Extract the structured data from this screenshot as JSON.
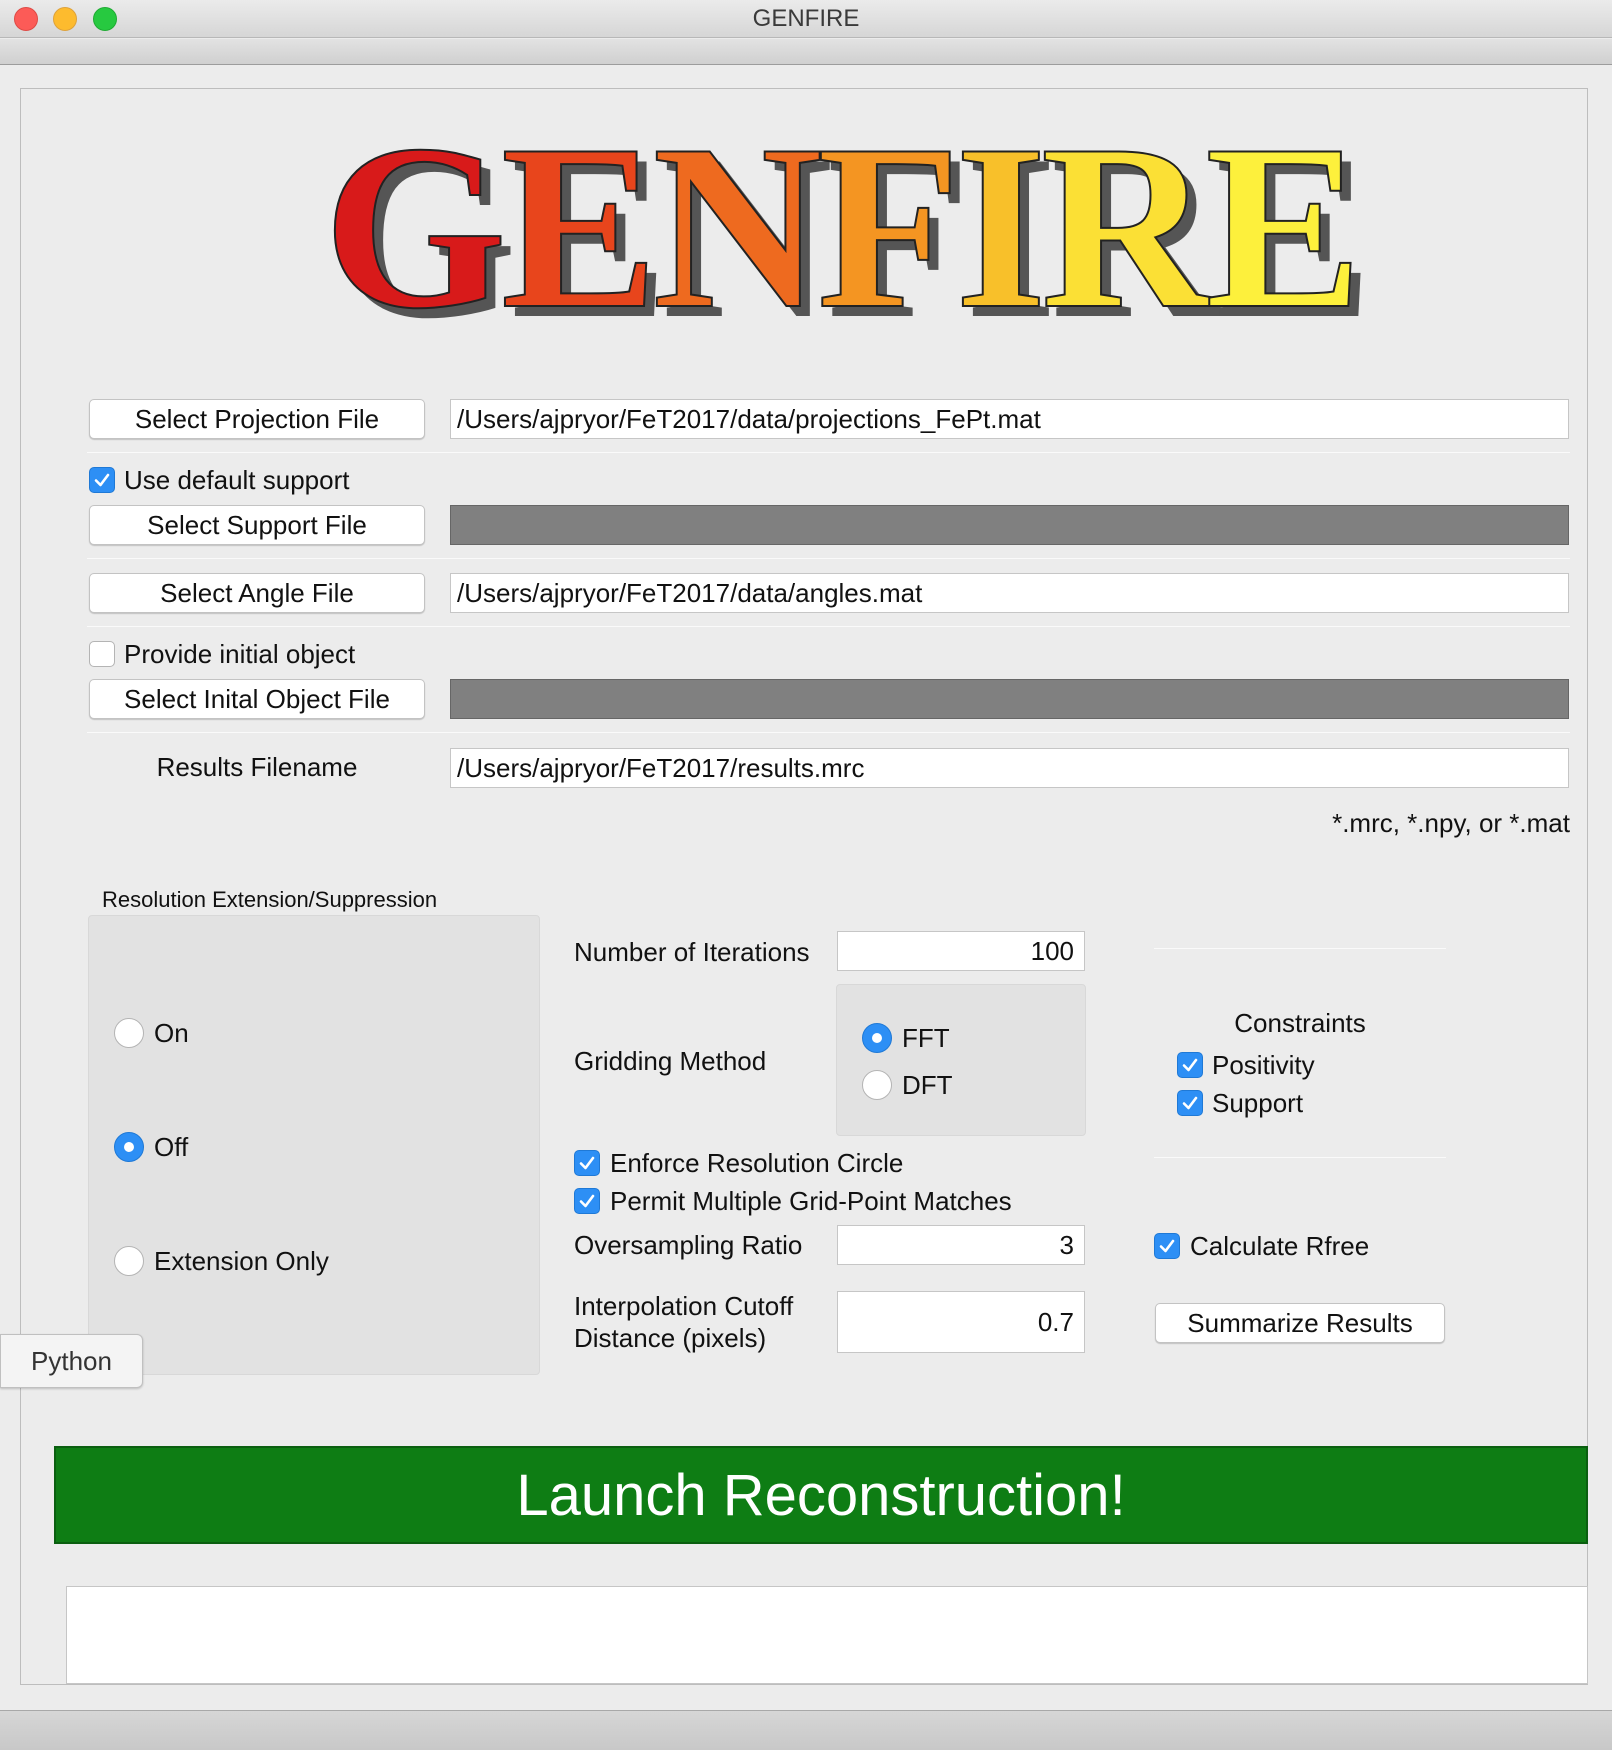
{
  "window": {
    "title": "GENFIRE"
  },
  "logo": {
    "letters": [
      {
        "ch": "G",
        "color": "#d81a1a"
      },
      {
        "ch": "E",
        "color": "#e8451c"
      },
      {
        "ch": "N",
        "color": "#ee6a1f"
      },
      {
        "ch": "F",
        "color": "#f49522"
      },
      {
        "ch": "I",
        "color": "#f8c02a"
      },
      {
        "ch": "R",
        "color": "#fbe035"
      },
      {
        "ch": "E",
        "color": "#fdf03c"
      }
    ]
  },
  "files": {
    "projection_button": "Select Projection File",
    "projection_path": "/Users/ajpryor/FeT2017/data/projections_FePt.mat",
    "use_default_support_label": "Use default support",
    "use_default_support_checked": true,
    "support_button": "Select Support File",
    "support_path": "",
    "angle_button": "Select Angle File",
    "angle_path": "/Users/ajpryor/FeT2017/data/angles.mat",
    "provide_initial_label": "Provide initial object",
    "provide_initial_checked": false,
    "initial_button": "Select Inital Object File",
    "initial_path": "",
    "results_label": "Results Filename",
    "results_path": "/Users/ajpryor/FeT2017/results.mrc",
    "results_hint": "*.mrc, *.npy, or *.mat"
  },
  "resolution": {
    "group_title": "Resolution Extension/Suppression",
    "options": [
      {
        "label": "On",
        "selected": false
      },
      {
        "label": "Off",
        "selected": true
      },
      {
        "label": "Extension Only",
        "selected": false
      }
    ]
  },
  "params": {
    "iterations_label": "Number of Iterations",
    "iterations_value": "100",
    "gridding_label": "Gridding Method",
    "gridding_options": [
      {
        "label": "FFT",
        "selected": true
      },
      {
        "label": "DFT",
        "selected": false
      }
    ],
    "enforce_resolution_label": "Enforce Resolution Circle",
    "enforce_resolution_checked": true,
    "permit_multiple_label": "Permit Multiple Grid-Point Matches",
    "permit_multiple_checked": true,
    "oversampling_label": "Oversampling Ratio",
    "oversampling_value": "3",
    "interp_label_line1": "Interpolation Cutoff",
    "interp_label_line2": "Distance (pixels)",
    "interp_value": "0.7"
  },
  "constraints": {
    "title": "Constraints",
    "positivity_label": "Positivity",
    "positivity_checked": true,
    "support_label": "Support",
    "support_checked": true,
    "rfree_label": "Calculate Rfree",
    "rfree_checked": true,
    "summarize_button": "Summarize Results"
  },
  "launch": {
    "label": "Launch Reconstruction!",
    "color": "#0e7d14"
  },
  "python_tab": {
    "label": "Python"
  },
  "log": {
    "text": ""
  }
}
